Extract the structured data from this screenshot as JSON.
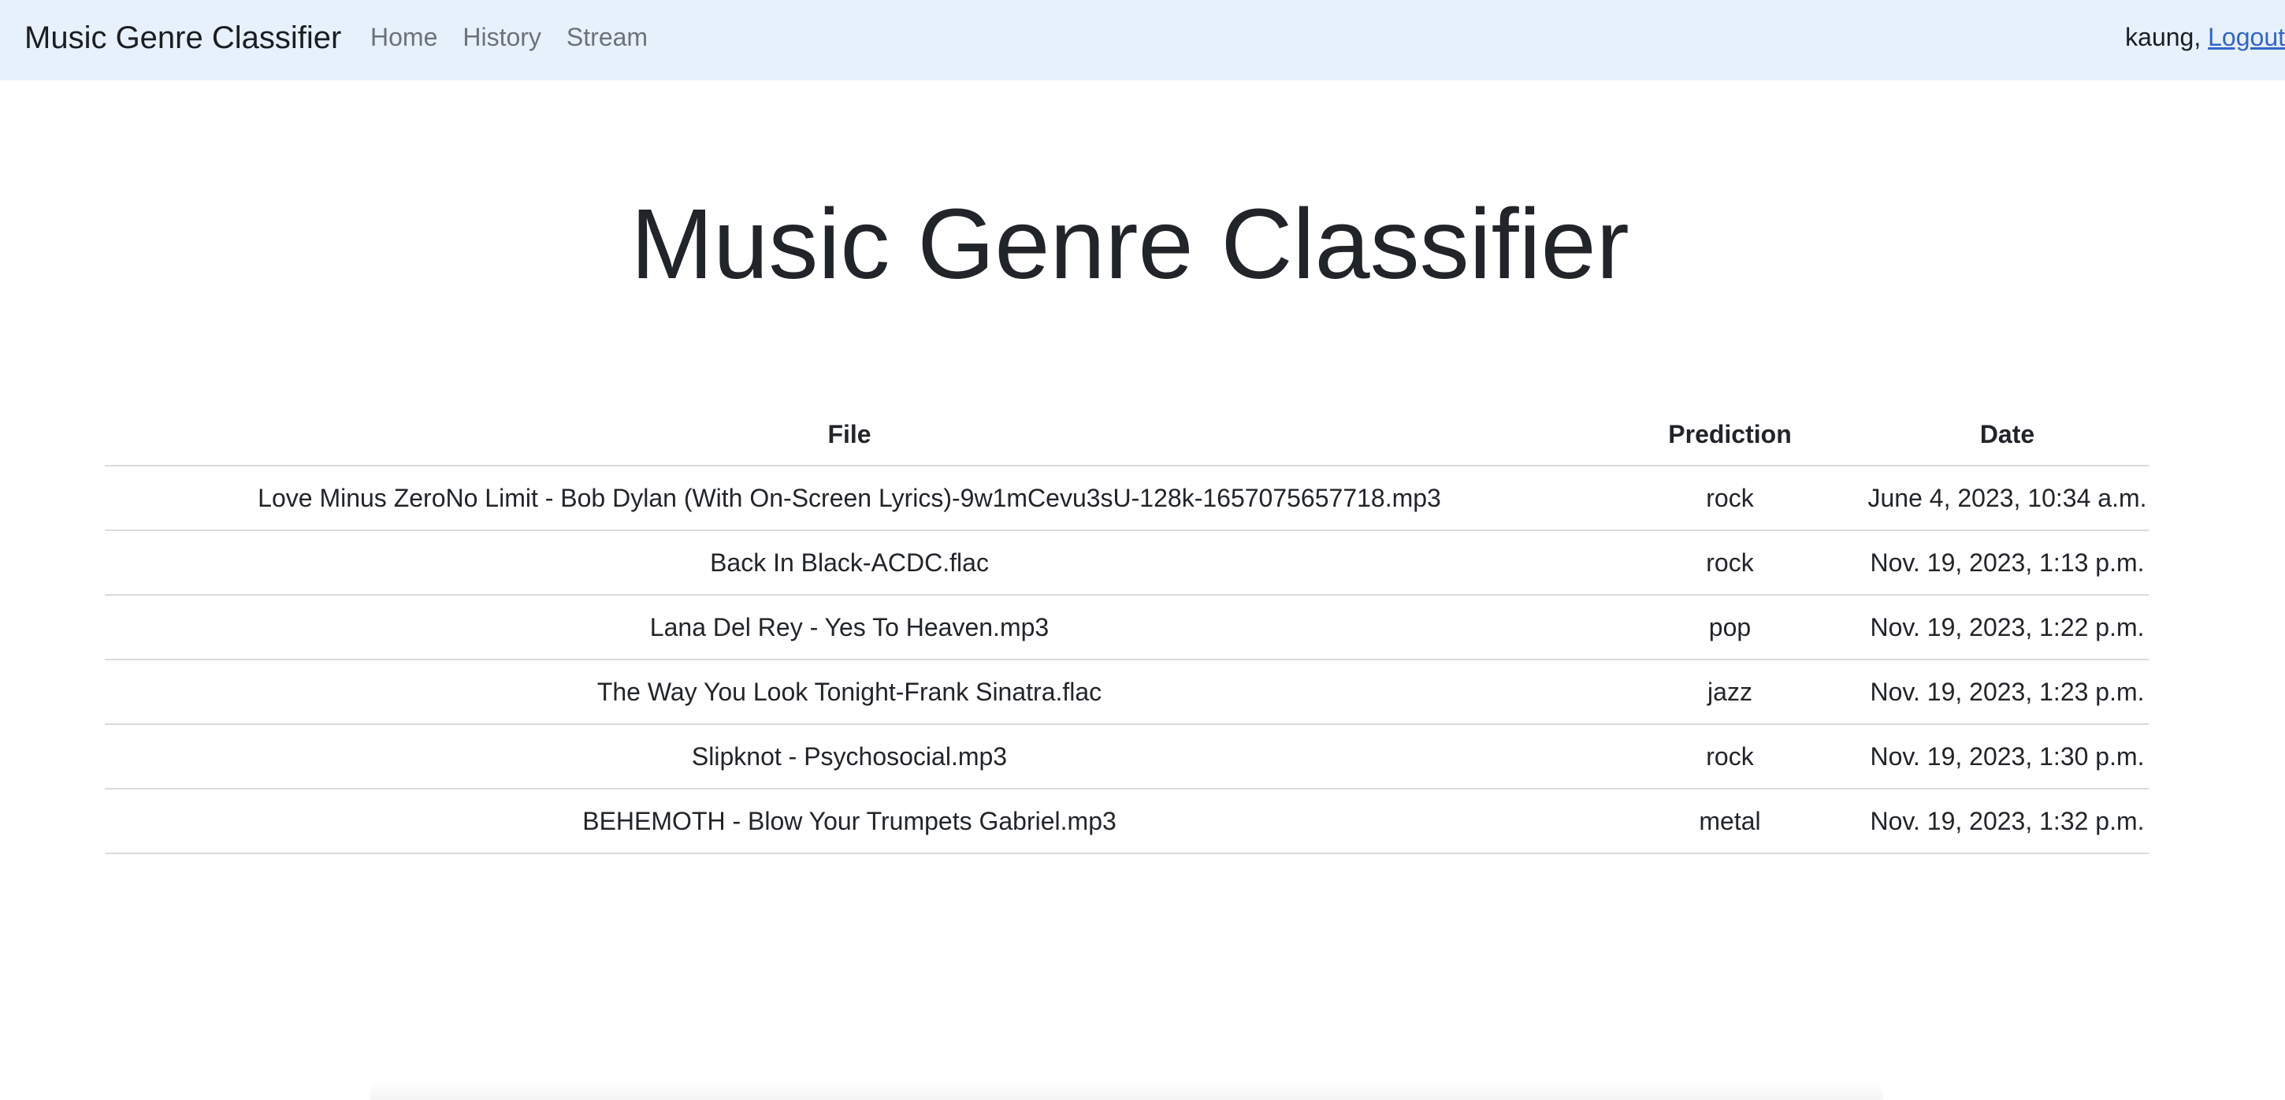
{
  "navbar": {
    "brand": "Music Genre Classifier",
    "links": [
      "Home",
      "History",
      "Stream"
    ],
    "user_greeting": "kaung,",
    "logout_label": "Logout"
  },
  "main": {
    "title": "Music Genre Classifier",
    "table": {
      "headers": [
        "File",
        "Prediction",
        "Date"
      ],
      "rows": [
        [
          "Love Minus ZeroNo Limit - Bob Dylan (With On-Screen Lyrics)-9w1mCevu3sU-128k-1657075657718.mp3",
          "rock",
          "June 4, 2023, 10:34 a.m."
        ],
        [
          "Back In Black-ACDC.flac",
          "rock",
          "Nov. 19, 2023, 1:13 p.m."
        ],
        [
          "Lana Del Rey - Yes To Heaven.mp3",
          "pop",
          "Nov. 19, 2023, 1:22 p.m."
        ],
        [
          "The Way You Look Tonight-Frank Sinatra.flac",
          "jazz",
          "Nov. 19, 2023, 1:23 p.m."
        ],
        [
          "Slipknot - Psychosocial.mp3",
          "rock",
          "Nov. 19, 2023, 1:30 p.m."
        ],
        [
          "BEHEMOTH - Blow Your Trumpets Gabriel.mp3",
          "metal",
          "Nov. 19, 2023, 1:32 p.m."
        ]
      ]
    }
  },
  "colors": {
    "navbar_bg": "#e7f1fb",
    "link": "#3366cc",
    "nav_link": "#6c7278",
    "text": "#212529"
  }
}
